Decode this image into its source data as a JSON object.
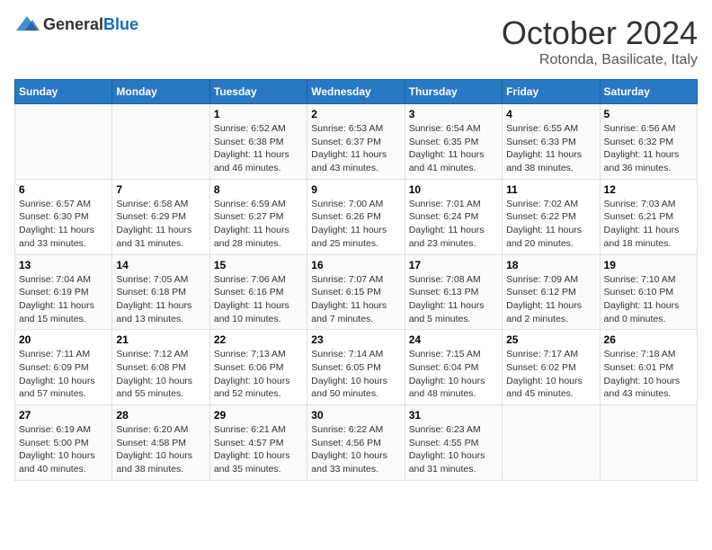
{
  "header": {
    "logo_general": "General",
    "logo_blue": "Blue",
    "month_title": "October 2024",
    "subtitle": "Rotonda, Basilicate, Italy"
  },
  "days_of_week": [
    "Sunday",
    "Monday",
    "Tuesday",
    "Wednesday",
    "Thursday",
    "Friday",
    "Saturday"
  ],
  "weeks": [
    [
      {
        "day": "",
        "sunrise": "",
        "sunset": "",
        "daylight": ""
      },
      {
        "day": "",
        "sunrise": "",
        "sunset": "",
        "daylight": ""
      },
      {
        "day": "1",
        "sunrise": "Sunrise: 6:52 AM",
        "sunset": "Sunset: 6:38 PM",
        "daylight": "Daylight: 11 hours and 46 minutes."
      },
      {
        "day": "2",
        "sunrise": "Sunrise: 6:53 AM",
        "sunset": "Sunset: 6:37 PM",
        "daylight": "Daylight: 11 hours and 43 minutes."
      },
      {
        "day": "3",
        "sunrise": "Sunrise: 6:54 AM",
        "sunset": "Sunset: 6:35 PM",
        "daylight": "Daylight: 11 hours and 41 minutes."
      },
      {
        "day": "4",
        "sunrise": "Sunrise: 6:55 AM",
        "sunset": "Sunset: 6:33 PM",
        "daylight": "Daylight: 11 hours and 38 minutes."
      },
      {
        "day": "5",
        "sunrise": "Sunrise: 6:56 AM",
        "sunset": "Sunset: 6:32 PM",
        "daylight": "Daylight: 11 hours and 36 minutes."
      }
    ],
    [
      {
        "day": "6",
        "sunrise": "Sunrise: 6:57 AM",
        "sunset": "Sunset: 6:30 PM",
        "daylight": "Daylight: 11 hours and 33 minutes."
      },
      {
        "day": "7",
        "sunrise": "Sunrise: 6:58 AM",
        "sunset": "Sunset: 6:29 PM",
        "daylight": "Daylight: 11 hours and 31 minutes."
      },
      {
        "day": "8",
        "sunrise": "Sunrise: 6:59 AM",
        "sunset": "Sunset: 6:27 PM",
        "daylight": "Daylight: 11 hours and 28 minutes."
      },
      {
        "day": "9",
        "sunrise": "Sunrise: 7:00 AM",
        "sunset": "Sunset: 6:26 PM",
        "daylight": "Daylight: 11 hours and 25 minutes."
      },
      {
        "day": "10",
        "sunrise": "Sunrise: 7:01 AM",
        "sunset": "Sunset: 6:24 PM",
        "daylight": "Daylight: 11 hours and 23 minutes."
      },
      {
        "day": "11",
        "sunrise": "Sunrise: 7:02 AM",
        "sunset": "Sunset: 6:22 PM",
        "daylight": "Daylight: 11 hours and 20 minutes."
      },
      {
        "day": "12",
        "sunrise": "Sunrise: 7:03 AM",
        "sunset": "Sunset: 6:21 PM",
        "daylight": "Daylight: 11 hours and 18 minutes."
      }
    ],
    [
      {
        "day": "13",
        "sunrise": "Sunrise: 7:04 AM",
        "sunset": "Sunset: 6:19 PM",
        "daylight": "Daylight: 11 hours and 15 minutes."
      },
      {
        "day": "14",
        "sunrise": "Sunrise: 7:05 AM",
        "sunset": "Sunset: 6:18 PM",
        "daylight": "Daylight: 11 hours and 13 minutes."
      },
      {
        "day": "15",
        "sunrise": "Sunrise: 7:06 AM",
        "sunset": "Sunset: 6:16 PM",
        "daylight": "Daylight: 11 hours and 10 minutes."
      },
      {
        "day": "16",
        "sunrise": "Sunrise: 7:07 AM",
        "sunset": "Sunset: 6:15 PM",
        "daylight": "Daylight: 11 hours and 7 minutes."
      },
      {
        "day": "17",
        "sunrise": "Sunrise: 7:08 AM",
        "sunset": "Sunset: 6:13 PM",
        "daylight": "Daylight: 11 hours and 5 minutes."
      },
      {
        "day": "18",
        "sunrise": "Sunrise: 7:09 AM",
        "sunset": "Sunset: 6:12 PM",
        "daylight": "Daylight: 11 hours and 2 minutes."
      },
      {
        "day": "19",
        "sunrise": "Sunrise: 7:10 AM",
        "sunset": "Sunset: 6:10 PM",
        "daylight": "Daylight: 11 hours and 0 minutes."
      }
    ],
    [
      {
        "day": "20",
        "sunrise": "Sunrise: 7:11 AM",
        "sunset": "Sunset: 6:09 PM",
        "daylight": "Daylight: 10 hours and 57 minutes."
      },
      {
        "day": "21",
        "sunrise": "Sunrise: 7:12 AM",
        "sunset": "Sunset: 6:08 PM",
        "daylight": "Daylight: 10 hours and 55 minutes."
      },
      {
        "day": "22",
        "sunrise": "Sunrise: 7:13 AM",
        "sunset": "Sunset: 6:06 PM",
        "daylight": "Daylight: 10 hours and 52 minutes."
      },
      {
        "day": "23",
        "sunrise": "Sunrise: 7:14 AM",
        "sunset": "Sunset: 6:05 PM",
        "daylight": "Daylight: 10 hours and 50 minutes."
      },
      {
        "day": "24",
        "sunrise": "Sunrise: 7:15 AM",
        "sunset": "Sunset: 6:04 PM",
        "daylight": "Daylight: 10 hours and 48 minutes."
      },
      {
        "day": "25",
        "sunrise": "Sunrise: 7:17 AM",
        "sunset": "Sunset: 6:02 PM",
        "daylight": "Daylight: 10 hours and 45 minutes."
      },
      {
        "day": "26",
        "sunrise": "Sunrise: 7:18 AM",
        "sunset": "Sunset: 6:01 PM",
        "daylight": "Daylight: 10 hours and 43 minutes."
      }
    ],
    [
      {
        "day": "27",
        "sunrise": "Sunrise: 6:19 AM",
        "sunset": "Sunset: 5:00 PM",
        "daylight": "Daylight: 10 hours and 40 minutes."
      },
      {
        "day": "28",
        "sunrise": "Sunrise: 6:20 AM",
        "sunset": "Sunset: 4:58 PM",
        "daylight": "Daylight: 10 hours and 38 minutes."
      },
      {
        "day": "29",
        "sunrise": "Sunrise: 6:21 AM",
        "sunset": "Sunset: 4:57 PM",
        "daylight": "Daylight: 10 hours and 35 minutes."
      },
      {
        "day": "30",
        "sunrise": "Sunrise: 6:22 AM",
        "sunset": "Sunset: 4:56 PM",
        "daylight": "Daylight: 10 hours and 33 minutes."
      },
      {
        "day": "31",
        "sunrise": "Sunrise: 6:23 AM",
        "sunset": "Sunset: 4:55 PM",
        "daylight": "Daylight: 10 hours and 31 minutes."
      },
      {
        "day": "",
        "sunrise": "",
        "sunset": "",
        "daylight": ""
      },
      {
        "day": "",
        "sunrise": "",
        "sunset": "",
        "daylight": ""
      }
    ]
  ]
}
